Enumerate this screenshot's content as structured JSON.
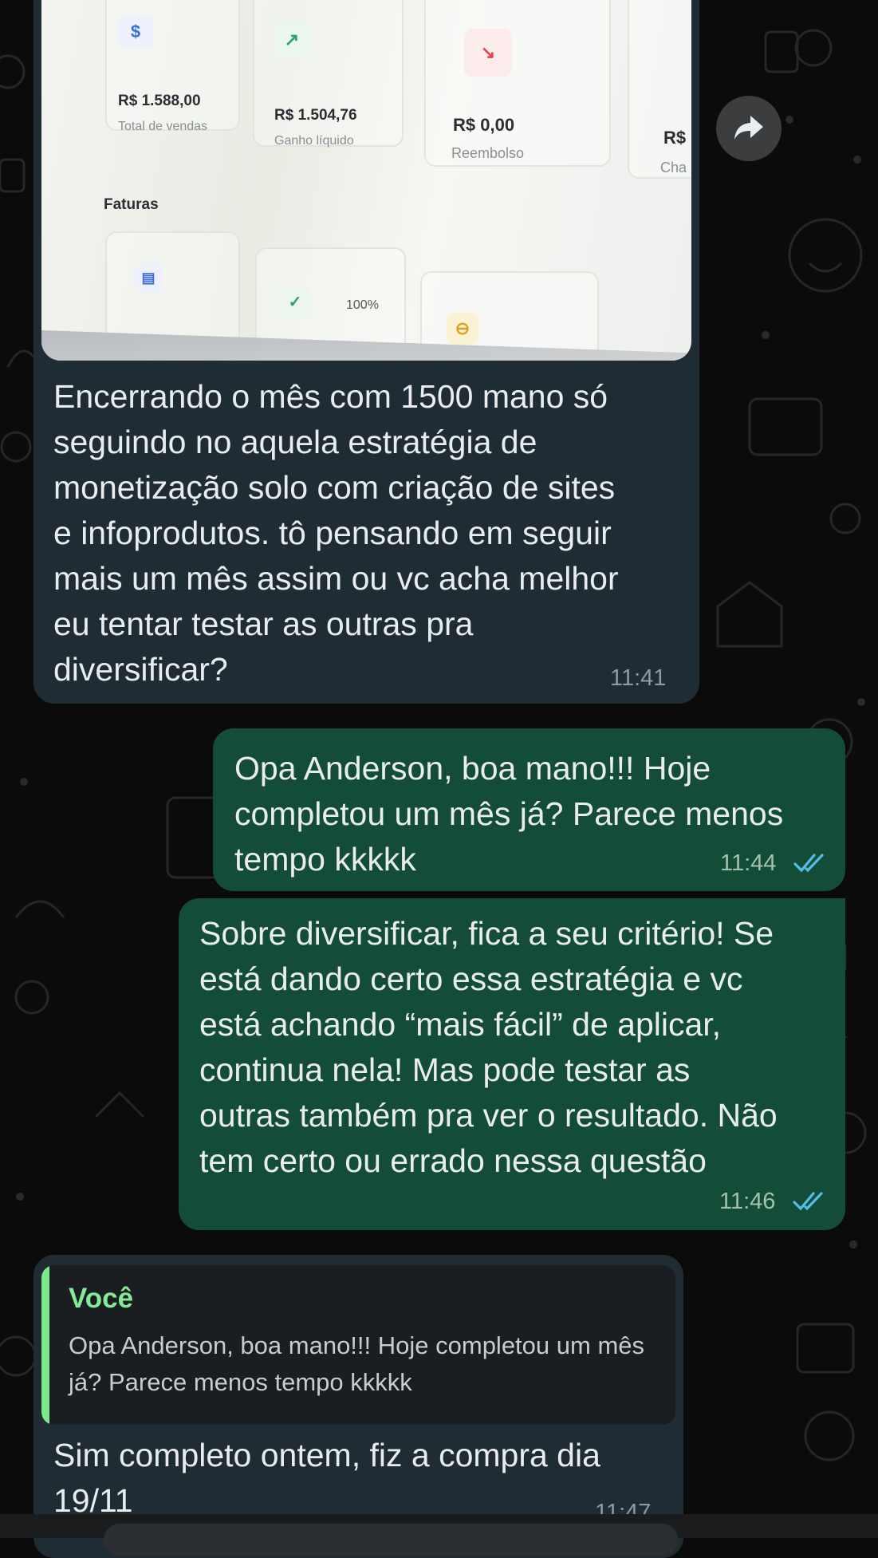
{
  "photo": {
    "cards": [
      {
        "icon": "$",
        "icon_color": "#3b6fd8",
        "value": "R$ 1.588,00",
        "label": "Total de vendas"
      },
      {
        "icon": "↗",
        "icon_color": "#2fa36b",
        "value": "R$ 1.504,76",
        "label": "Ganho líquido"
      },
      {
        "icon": "↘",
        "icon_color": "#e0474c",
        "value": "R$ 0,00",
        "label": "Reembolso"
      },
      {
        "icon": "",
        "icon_color": "#3b6fd8",
        "value": "R$",
        "label": "Cha"
      }
    ],
    "section_title": "Faturas",
    "percent": "100%"
  },
  "messages": [
    {
      "text": "Encerrando o mês com 1500 mano só\nseguindo no aquela estratégia de\nmonetização solo com criação de sites\ne infoprodutos. tô pensando em seguir\nmais um mês assim ou vc acha melhor\neu tentar testar as outras pra\ndiversificar?",
      "time": "11:41"
    },
    {
      "text": "Opa Anderson, boa mano!!! Hoje\ncompletou um mês já? Parece menos\ntempo kkkkk",
      "time": "11:44"
    },
    {
      "text": "Sobre diversificar, fica a seu critério! Se\nestá dando certo essa estratégia e vc\nestá achando “mais fácil” de aplicar,\ncontinua nela! Mas pode testar as\noutras também pra ver o resultado. Não\ntem certo ou errado nessa questão",
      "time": "11:46"
    },
    {
      "text": "Sim completo ontem, fiz a compra dia\n19/11",
      "time": "11:47"
    }
  ],
  "quote": {
    "author": "Você",
    "text": "Opa Anderson, boa mano!!! Hoje completou um mês já? Parece menos tempo kkkkk"
  },
  "colors": {
    "incoming": "#202c33",
    "outgoing": "#144d37",
    "read_ticks": "#53bdeb",
    "quote_accent": "#7bea8f"
  }
}
